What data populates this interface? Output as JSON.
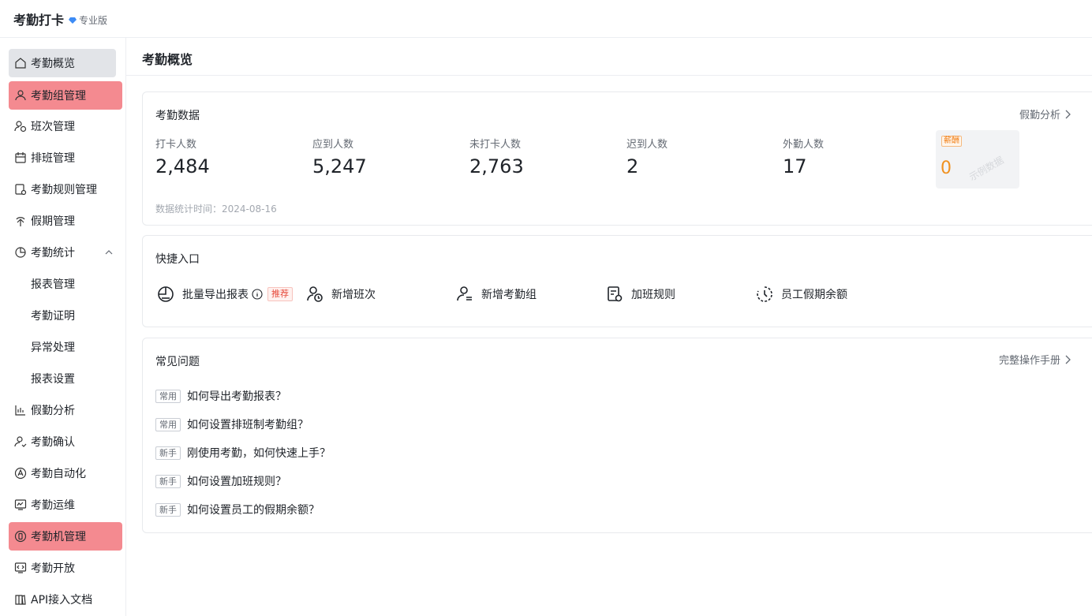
{
  "header": {
    "app_title": "考勤打卡",
    "edition": "专业版",
    "edition_icon": "diamond-icon"
  },
  "sidebar": {
    "items": [
      {
        "label": "考勤概览",
        "icon": "home-icon"
      },
      {
        "label": "考勤组管理",
        "icon": "user-group-icon"
      },
      {
        "label": "班次管理",
        "icon": "shift-icon"
      },
      {
        "label": "排班管理",
        "icon": "calendar-icon"
      },
      {
        "label": "考勤规则管理",
        "icon": "rule-icon"
      },
      {
        "label": "假期管理",
        "icon": "palm-icon"
      },
      {
        "label": "考勤统计",
        "icon": "pie-icon"
      },
      {
        "label": "报表管理"
      },
      {
        "label": "考勤证明"
      },
      {
        "label": "异常处理"
      },
      {
        "label": "报表设置"
      },
      {
        "label": "假勤分析",
        "icon": "bar-chart-icon"
      },
      {
        "label": "考勤确认",
        "icon": "user-check-icon"
      },
      {
        "label": "考勤自动化",
        "icon": "auto-icon"
      },
      {
        "label": "考勤运维",
        "icon": "monitor-icon"
      },
      {
        "label": "考勤机管理",
        "icon": "device-icon"
      },
      {
        "label": "考勤开放",
        "icon": "open-icon"
      },
      {
        "label": "API接入文档",
        "icon": "doc-icon"
      }
    ]
  },
  "main": {
    "title": "考勤概览"
  },
  "attendance_data": {
    "title": "考勤数据",
    "link": "假勤分析",
    "stats": [
      {
        "label": "打卡人数",
        "value": "2,484"
      },
      {
        "label": "应到人数",
        "value": "5,247"
      },
      {
        "label": "未打卡人数",
        "value": "2,763"
      },
      {
        "label": "迟到人数",
        "value": "2"
      },
      {
        "label": "外勤人数",
        "value": "17"
      }
    ],
    "salary": {
      "tag": "薪酬",
      "value": "0",
      "watermark": "示例数据"
    },
    "time": "数据统计时间：2024-08-16"
  },
  "quick_entry": {
    "title": "快捷入口",
    "items": [
      {
        "label": "批量导出报表",
        "icon": "export-report-icon",
        "tag": "推荐"
      },
      {
        "label": "新增班次",
        "icon": "add-shift-icon"
      },
      {
        "label": "新增考勤组",
        "icon": "add-group-icon"
      },
      {
        "label": "加班规则",
        "icon": "overtime-rule-icon"
      },
      {
        "label": "员工假期余额",
        "icon": "leave-balance-icon"
      }
    ]
  },
  "faq": {
    "title": "常见问题",
    "link": "完整操作手册",
    "items": [
      {
        "tag": "常用",
        "text": "如何导出考勤报表？"
      },
      {
        "tag": "常用",
        "text": "如何设置排班制考勤组？"
      },
      {
        "tag": "新手",
        "text": "刚使用考勤，如何快速上手？"
      },
      {
        "tag": "新手",
        "text": "如何设置加班规则？"
      },
      {
        "tag": "新手",
        "text": "如何设置员工的假期余额？"
      }
    ]
  },
  "colors": {
    "highlight": "#f48a90",
    "active": "#e2e4e8",
    "salary": "#f0911f"
  }
}
